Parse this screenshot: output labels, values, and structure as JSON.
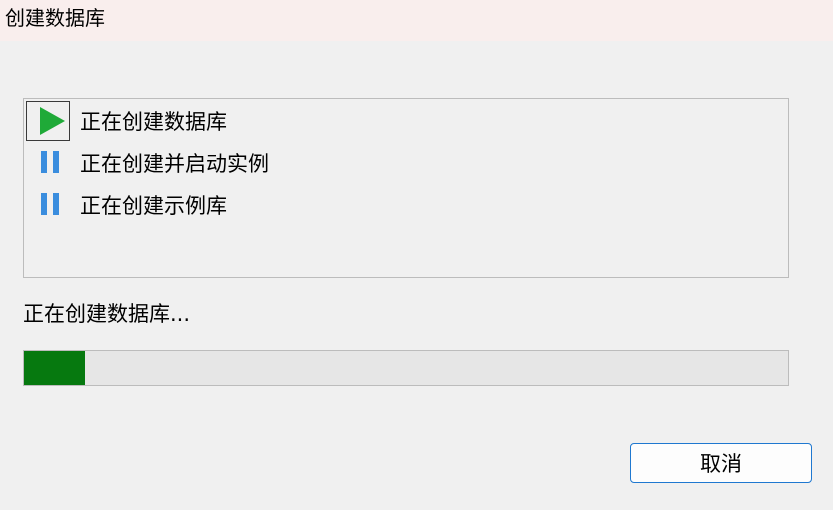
{
  "window": {
    "title": "创建数据库"
  },
  "steps": [
    {
      "label": "正在创建数据库",
      "state": "running",
      "icon": "play-icon"
    },
    {
      "label": "正在创建并启动实例",
      "state": "pending",
      "icon": "pause-icon"
    },
    {
      "label": "正在创建示例库",
      "state": "pending",
      "icon": "pause-icon"
    }
  ],
  "status": {
    "text": "正在创建数据库..."
  },
  "progress": {
    "fraction": 0.08
  },
  "buttons": {
    "cancel_label": "取消"
  },
  "colors": {
    "progress_fill": "#06790f",
    "play_icon": "#1faa38",
    "pause_icon": "#3a8dde",
    "titlebar_bg": "#f9eeed",
    "button_border": "#1f78d0"
  }
}
